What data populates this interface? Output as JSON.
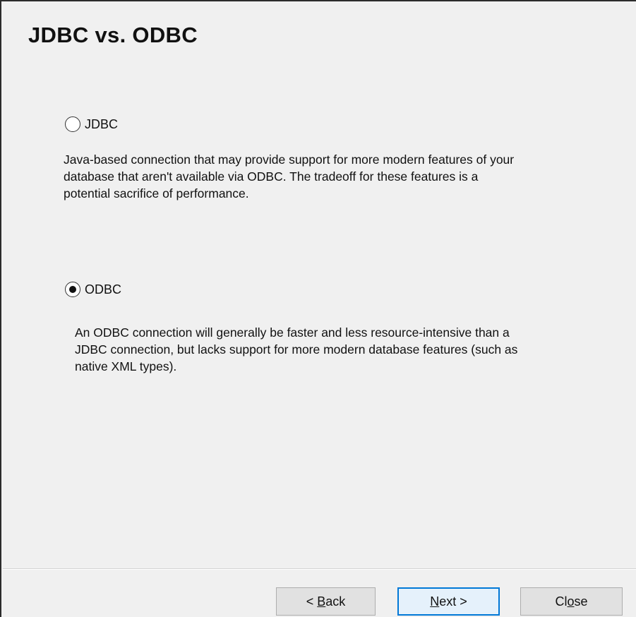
{
  "page": {
    "title": "JDBC vs. ODBC"
  },
  "options": [
    {
      "label": "JDBC",
      "selected": false,
      "description": "Java-based connection that may provide support for more modern features of your database that aren't available via ODBC. The tradeoff for these features is a potential sacrifice of performance."
    },
    {
      "label": "ODBC",
      "selected": true,
      "description": "An ODBC connection will generally be faster and less resource-intensive than a JDBC connection, but lacks support for more modern database features (such as native XML types)."
    }
  ],
  "buttons": {
    "back": {
      "pre": "< ",
      "mnemonic": "B",
      "post": "ack"
    },
    "next": {
      "pre": "",
      "mnemonic": "N",
      "post": "ext >"
    },
    "close": {
      "pre": "Cl",
      "mnemonic": "o",
      "post": "se"
    }
  },
  "colors": {
    "dialog_background": "#f0f0f0",
    "default_button_border": "#0078d7"
  }
}
